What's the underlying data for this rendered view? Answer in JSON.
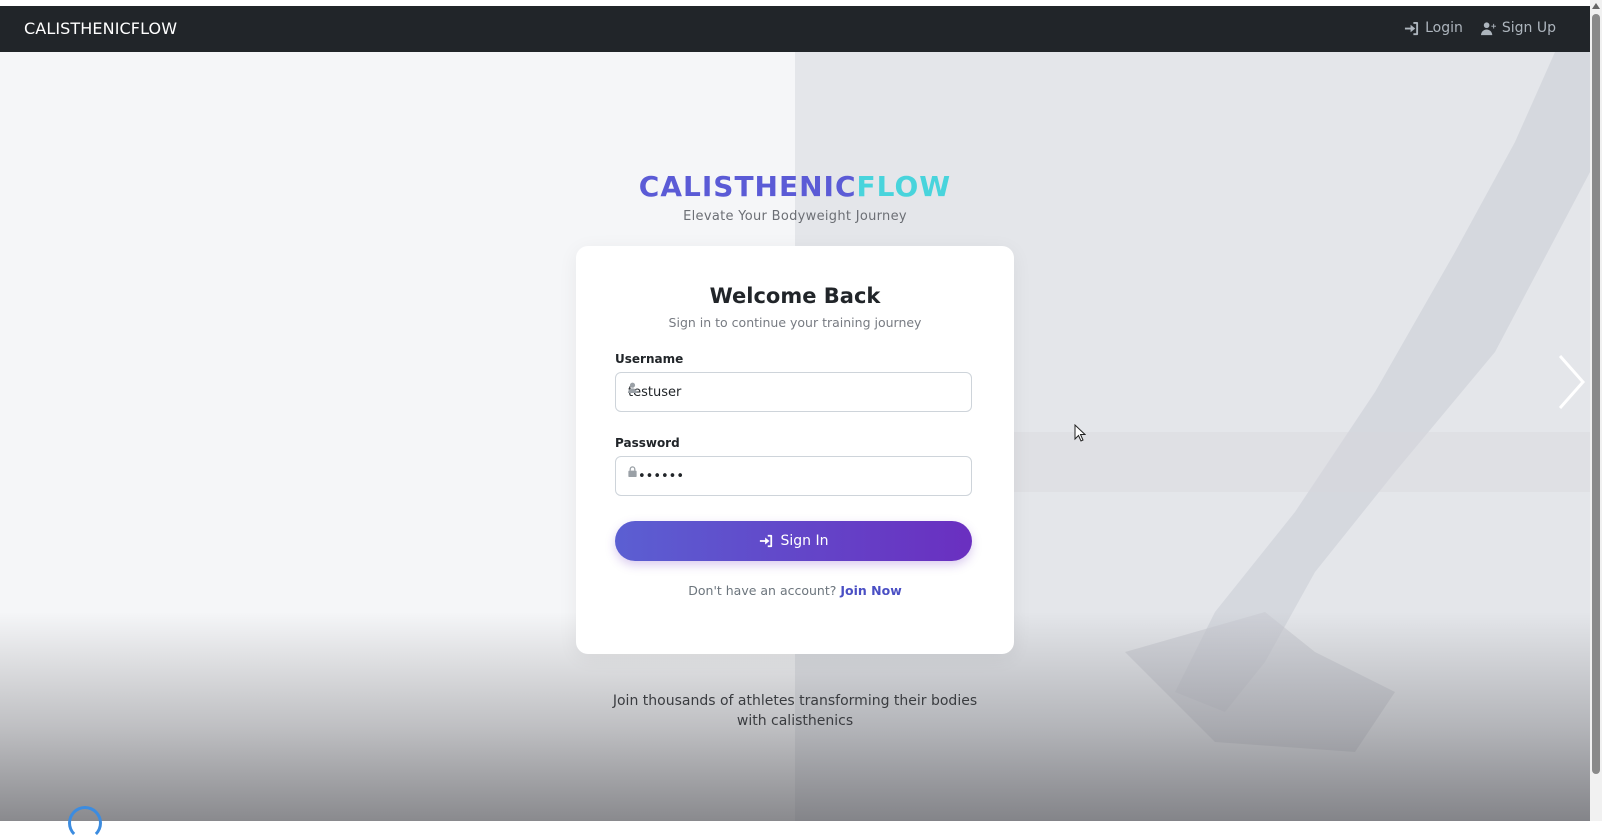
{
  "navbar": {
    "brand": "CALISTHENICFLOW",
    "links": [
      {
        "label": "Login",
        "icon": "sign-in-icon"
      },
      {
        "label": "Sign Up",
        "icon": "user-plus-icon"
      }
    ]
  },
  "hero": {
    "logo_part1": "CALISTHENIC",
    "logo_part2": "FLOW",
    "tagline": "Elevate Your Bodyweight Journey",
    "footer_text": "Join thousands of athletes transforming their bodies with calisthenics"
  },
  "login_card": {
    "title": "Welcome Back",
    "subtitle": "Sign in to continue your training journey",
    "username_label": "Username",
    "username_value": "testuser",
    "password_label": "Password",
    "password_value": "••••••",
    "submit_label": "Sign In",
    "join_prompt": "Don't have an account?",
    "join_link": "Join Now"
  },
  "colors": {
    "navbar_bg": "#212529",
    "logo_primary": "#5b5bd6",
    "logo_accent": "#48d4dc",
    "button_gradient_start": "#5b5fd2",
    "button_gradient_end": "#6a2fc0"
  }
}
